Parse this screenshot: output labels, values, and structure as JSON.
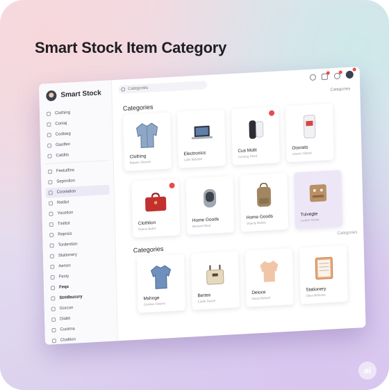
{
  "headline": "Smart Stock Item Category",
  "watermark": "ai",
  "sidebar": {
    "brand": "Smart Stock",
    "items": [
      {
        "label": "Clothing"
      },
      {
        "label": "Coniaj"
      },
      {
        "label": "Codiseg"
      },
      {
        "label": "Gaolfen"
      },
      {
        "label": "Catdits"
      },
      {
        "label": "Festutfins"
      },
      {
        "label": "Sepnnlion"
      },
      {
        "label": "Cooriation"
      },
      {
        "label": "Retilot"
      },
      {
        "label": "Yocetion"
      },
      {
        "label": "Tinittot"
      },
      {
        "label": "Reprsis"
      },
      {
        "label": "Tordention"
      },
      {
        "label": "Stationery"
      },
      {
        "label": "Aenon"
      },
      {
        "label": "Fexty"
      },
      {
        "label": "Feqs"
      },
      {
        "label": "Stridbussry"
      },
      {
        "label": "Gorcon"
      },
      {
        "label": "Dislet"
      },
      {
        "label": "Cuotrna"
      },
      {
        "label": "Clodtion"
      }
    ]
  },
  "topbar": {
    "search_placeholder": "Categories",
    "top_right_label": "Categories"
  },
  "section1": {
    "title": "Categories",
    "cards": [
      {
        "name": "Clothing",
        "sub": "Beteen Stbonis",
        "icon": "jacket-icon",
        "badge": false
      },
      {
        "name": "Electronics",
        "sub": "Latin Betodel",
        "icon": "laptop-icon",
        "badge": false
      },
      {
        "name": "Cus Molit",
        "sub": "Coneng Deed",
        "icon": "speaker-icon",
        "badge": true
      },
      {
        "name": "Ooorats",
        "sub": "Lirenis Ylidnet",
        "icon": "canister-icon",
        "badge": false
      },
      {
        "name": "Clothlion",
        "sub": "Deens Befrit",
        "icon": "briefcase-icon",
        "badge": true
      },
      {
        "name": "Home Goods",
        "sub": "Bereent Beal",
        "icon": "electronics-device-icon",
        "badge": false
      },
      {
        "name": "Home Goods",
        "sub": "Deenly Betels",
        "icon": "backpack-icon",
        "badge": false
      },
      {
        "name": "Tuivegte",
        "sub": "Levins Yerloe",
        "icon": "box-icon",
        "badge": false
      }
    ]
  },
  "section2": {
    "title": "Categories",
    "side_label": "Categories",
    "cards": [
      {
        "name": "Mshnge",
        "sub": "Cenees Fslerss",
        "icon": "shirt-icon"
      },
      {
        "name": "Bertes",
        "sub": "Caele Seach",
        "icon": "bag-icon"
      },
      {
        "name": "Deioce",
        "sub": "Deely Betosh",
        "icon": "blouse-icon"
      },
      {
        "name": "Stationery",
        "sub": "Dees Befuoas",
        "icon": "notebook-icon"
      }
    ]
  },
  "colors": {
    "accent": "#e84b4b",
    "highlight": "#ece6f7",
    "text": "#22222a"
  }
}
